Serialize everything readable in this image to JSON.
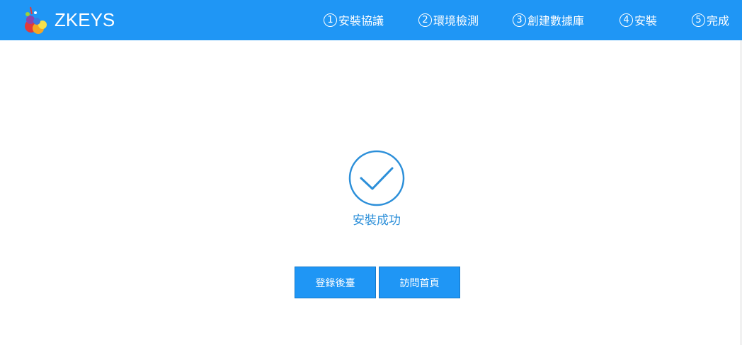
{
  "header": {
    "brand": "ZKEYS",
    "logo_icon": "zkeys-logo-icon",
    "background_color": "#1f96f5",
    "steps": [
      {
        "number": "1",
        "label": "安裝協議"
      },
      {
        "number": "2",
        "label": "環境檢測"
      },
      {
        "number": "3",
        "label": "創建數據庫"
      },
      {
        "number": "4",
        "label": "安裝"
      },
      {
        "number": "5",
        "label": "完成"
      }
    ]
  },
  "main": {
    "status_icon": "checkmark-circle-icon",
    "status_text": "安裝成功",
    "status_color": "#2c8fd9",
    "buttons": {
      "login_admin": "登錄後臺",
      "visit_home": "訪問首頁"
    }
  }
}
